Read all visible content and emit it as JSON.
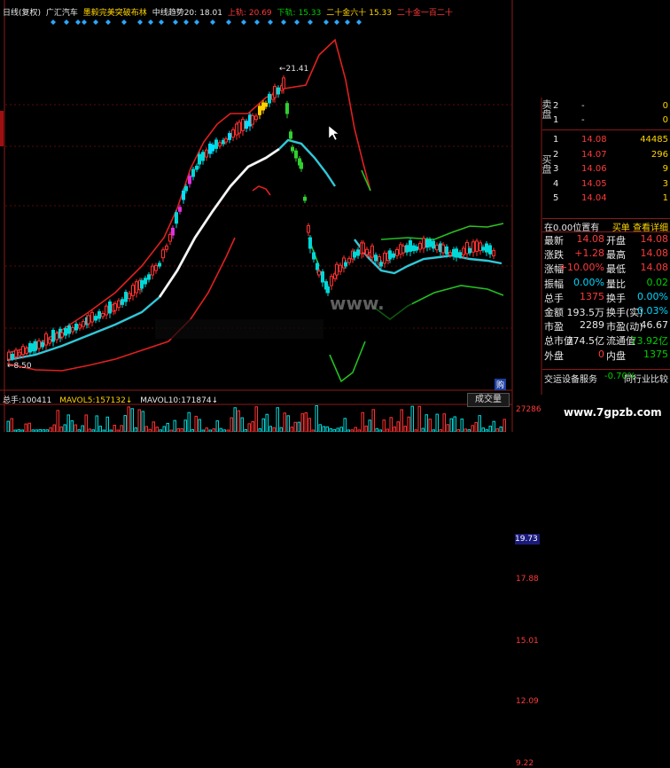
{
  "header": {
    "mode": "日线(复权)",
    "stock_name": "广汇汽车",
    "indicator": "墨毅完美突破布林",
    "mid_label": "中线趋势20:",
    "mid_val": "18.01",
    "up_label": "上轨:",
    "up_val": "20.69",
    "down_label": "下轨:",
    "down_val": "15.33",
    "tag1": "二十金六十",
    "tag1_val": "15.33",
    "tag2": "二十金一百二十"
  },
  "price_axis": [
    "19.73",
    "17.88",
    "15.01",
    "12.09",
    "9.22"
  ],
  "annotations": {
    "high_label": "21.41",
    "low_label": "8.50",
    "watermark1": "www.",
    "corner_tag": "购"
  },
  "volume_bar": {
    "vol_label": "总手:",
    "vol_val": "100411",
    "ma5_label": "MAVOL5:",
    "ma5_val": "157132",
    "ma10_label": "MAVOL10:",
    "ma10_val": "171874",
    "tab": "成交量",
    "axis_val": "27286"
  },
  "order_book": {
    "sell_label": "卖盘",
    "buy_label": "买盘",
    "sells": [
      {
        "lvl": "2",
        "price": "-",
        "vol": "0"
      },
      {
        "lvl": "1",
        "price": "-",
        "vol": "0"
      }
    ],
    "buys": [
      {
        "lvl": "1",
        "price": "14.08",
        "vol": "44485"
      },
      {
        "lvl": "2",
        "price": "14.07",
        "vol": "296"
      },
      {
        "lvl": "3",
        "price": "14.06",
        "vol": "9"
      },
      {
        "lvl": "4",
        "price": "14.05",
        "vol": "3"
      },
      {
        "lvl": "5",
        "price": "14.04",
        "vol": "1"
      }
    ]
  },
  "quote_header": {
    "left": "在0.00位置有",
    "right": "买单 查看详细"
  },
  "quotes": [
    {
      "l": "最新",
      "lv": "14.08",
      "r": "开盘",
      "rv": "14.08"
    },
    {
      "l": "涨跌",
      "lv": "+1.28",
      "r": "最高",
      "rv": "14.08"
    },
    {
      "l": "涨幅",
      "lv": "+10.00%",
      "r": "最低",
      "rv": "14.08"
    },
    {
      "l": "振幅",
      "lv": "0.00%",
      "r": "量比",
      "rv": "0.02"
    },
    {
      "l": "总手",
      "lv": "1375",
      "r": "换手",
      "rv": "0.00%"
    },
    {
      "l": "金额",
      "lv": "193.5万",
      "r": "换手(实)",
      "rv": "0.03%"
    },
    {
      "l": "市盈",
      "lv": "2289",
      "r": "市盈(动)",
      "rv": "46.67"
    },
    {
      "l": "总市值",
      "lv": "774.5亿",
      "r": "流通值",
      "rv": "73.92亿"
    },
    {
      "l": "外盘",
      "lv": "0",
      "r": "内盘",
      "rv": "1375"
    }
  ],
  "footer": {
    "sector": "交运设备服务",
    "sector_chg": "-0.70%",
    "compare": "同行业比较",
    "site": "www.7gpzb.com"
  },
  "colors": {
    "up": "#ff3333",
    "down": "#00e0e0",
    "mid": "#30c0d0",
    "upper": "#e02020",
    "lower": "#22c022"
  }
}
